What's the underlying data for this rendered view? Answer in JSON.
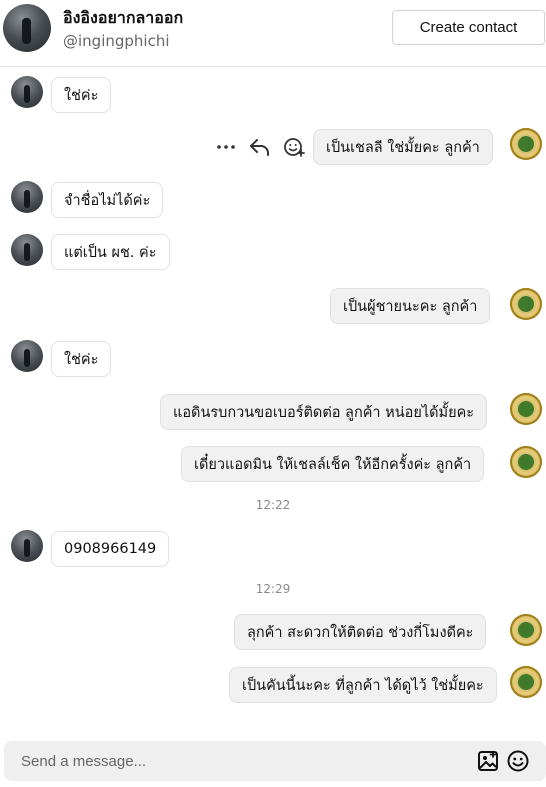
{
  "header": {
    "name": "อิงอิงอยากลาออก",
    "handle": "@ingingphichi",
    "create_contact_label": "Create contact"
  },
  "messages": [
    {
      "dir": "in",
      "text": "ใช่ค่ะ"
    },
    {
      "dir": "out",
      "text": "เป็นเชลลี ใช่มั้ยคะ ลูกค้า"
    },
    {
      "dir": "in",
      "text": "จำชื่อไม่ได้ค่ะ"
    },
    {
      "dir": "in",
      "text": "แต่เป็น ผช. ค่ะ"
    },
    {
      "dir": "out",
      "text": "เป็นผู้ชายนะคะ ลูกค้า"
    },
    {
      "dir": "in",
      "text": "ใช่ค่ะ"
    },
    {
      "dir": "out",
      "text": "แอดินรบกวนขอเบอร์ติดต่อ ลูกค้า หน่อยได้มั้ยคะ"
    },
    {
      "dir": "out",
      "text": "เดี๋ยวแอดมิน ให้เชลล์เช็ค ให้อีกครั้งค่ะ  ลูกค้า"
    },
    {
      "dir": "in",
      "text": "0908966149"
    },
    {
      "dir": "out",
      "text": "ลุกค้า สะดวกให้ติดต่อ ช่วงกี่โมงดีคะ"
    },
    {
      "dir": "out",
      "text": "เป็นคันนี้นะคะ ที่ลูกค้า ได้ดูไว้ ใช่มั้ยคะ"
    }
  ],
  "timestamps": [
    "12:22",
    "12:29"
  ],
  "message_actions": [
    "more-icon",
    "reply-icon",
    "add-reaction-icon"
  ],
  "composer": {
    "placeholder": "Send a message...",
    "icons": [
      "image-icon",
      "emoji-icon"
    ]
  }
}
